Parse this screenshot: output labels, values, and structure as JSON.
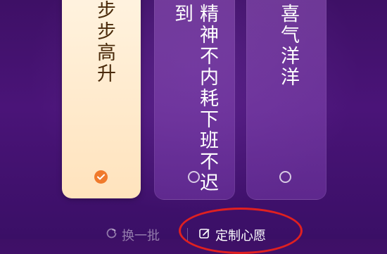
{
  "cards": [
    {
      "text": "步步高升",
      "selected": true
    },
    {
      "text": "精神不内耗下班不迟到",
      "selected": false
    },
    {
      "text": "喜气洋洋",
      "selected": false
    }
  ],
  "actions": {
    "swap_label": "换一批",
    "custom_label": "定制心愿"
  },
  "icons": {
    "swap": "refresh-icon",
    "custom": "edit-icon",
    "selected": "check-icon",
    "unselected": "radio-icon"
  },
  "colors": {
    "selected_card": "#ffe7c4",
    "accent": "#f07a2c",
    "background": "#4a1478",
    "annotation": "#e02020"
  }
}
